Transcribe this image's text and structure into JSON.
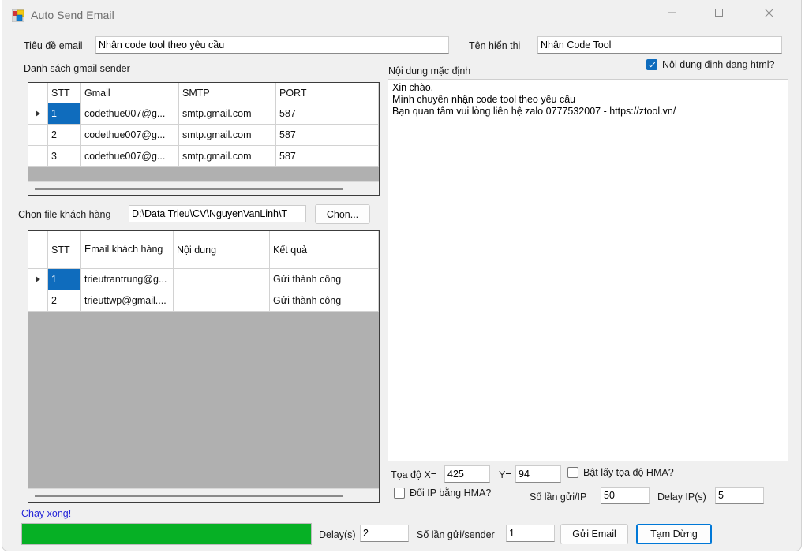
{
  "window": {
    "title": "Auto Send Email",
    "icon": "winforms-app-icon",
    "controls": {
      "minimize": "minimize-icon",
      "maximize": "maximize-icon",
      "close": "close-icon"
    }
  },
  "header": {
    "subject_label": "Tiêu đề email",
    "subject_value": "Nhận code tool theo yêu cầu",
    "display_name_label": "Tên hiển thị",
    "display_name_value": "Nhận Code Tool"
  },
  "sender_section": {
    "title": "Danh sách gmail sender",
    "columns": [
      "",
      "STT",
      "Gmail",
      "SMTP",
      "PORT"
    ],
    "rows": [
      {
        "marker": "▶",
        "stt": "1",
        "gmail": "codethue007@g...",
        "smtp": "smtp.gmail.com",
        "port": "587",
        "selected": true
      },
      {
        "marker": "",
        "stt": "2",
        "gmail": "codethue007@g...",
        "smtp": "smtp.gmail.com",
        "port": "587",
        "selected": false
      },
      {
        "marker": "",
        "stt": "3",
        "gmail": "codethue007@g...",
        "smtp": "smtp.gmail.com",
        "port": "587",
        "selected": false
      }
    ]
  },
  "customer_section": {
    "file_label": "Chọn file khách hàng",
    "file_path": "D:\\Data Trieu\\CV\\NguyenVanLinh\\T",
    "browse_button": "Chọn...",
    "columns": [
      "",
      "STT",
      "Email khách hàng",
      "Nội dung",
      "Kết quả"
    ],
    "rows": [
      {
        "marker": "▶",
        "stt": "1",
        "email": "trieutrantrung@g...",
        "content": "",
        "result": "Gửi thành công",
        "selected": true
      },
      {
        "marker": "",
        "stt": "2",
        "email": "trieuttwp@gmail....",
        "content": "",
        "result": "Gửi thành công",
        "selected": false
      }
    ]
  },
  "content_section": {
    "title": "Nội dung mặc định",
    "html_checkbox_label": "Nội dung định dạng html?",
    "html_checkbox_checked": true,
    "body": "Xin chào,\nMình chuyên nhận code tool theo yêu cầu\nBạn quan tâm vui lòng liên hệ zalo 0777532007 - https://ztool.vn/"
  },
  "hma_section": {
    "coord_label": "Tọa độ X=",
    "coord_x": "425",
    "y_label": "Y=",
    "coord_y": "94",
    "enable_coord_label": "Bật lấy tọa độ HMA?",
    "enable_coord_checked": false,
    "change_ip_label": "Đổi IP bằng HMA?",
    "change_ip_checked": false,
    "sends_per_ip_label": "Số lần gửi/IP",
    "sends_per_ip_value": "50",
    "delay_ip_label": "Delay IP(s)",
    "delay_ip_value": "5"
  },
  "footer": {
    "status": "Chạy xong!",
    "progress_percent": 100,
    "progress_color": "#06b025",
    "delay_label": "Delay(s)",
    "delay_value": "2",
    "sends_per_sender_label": "Số lần gửi/sender",
    "sends_per_sender_value": "1",
    "send_button": "Gửi Email",
    "pause_button": "Tạm Dừng"
  }
}
